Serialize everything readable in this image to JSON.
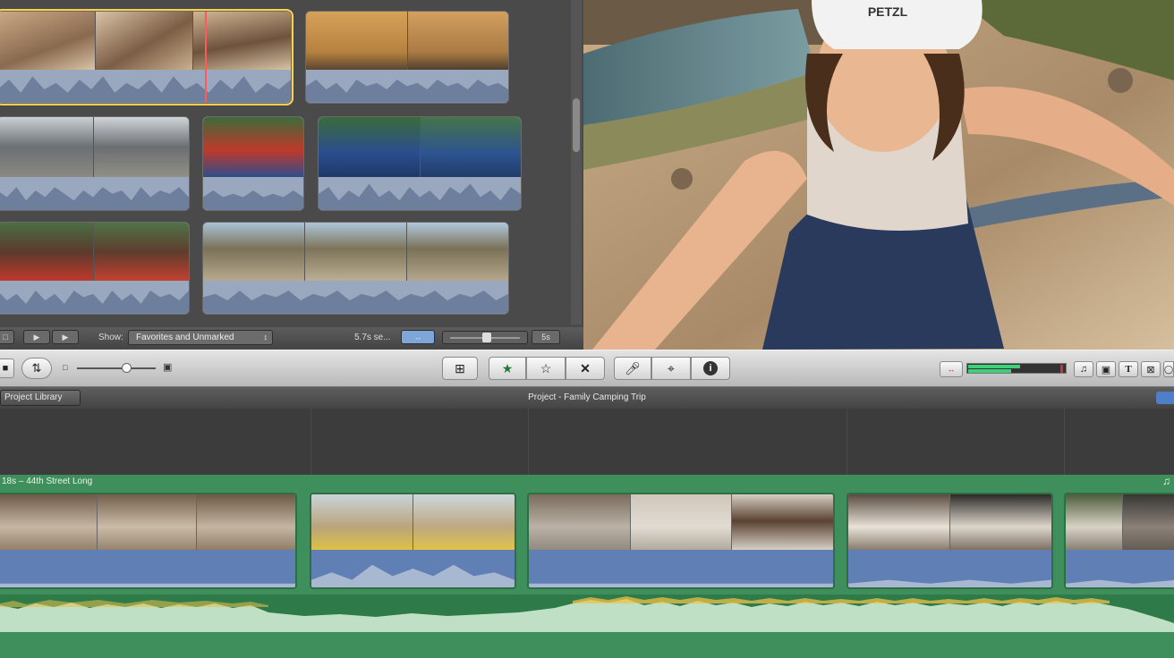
{
  "browser": {
    "show_label": "Show:",
    "show_filter": "Favorites and Unmarked",
    "clip_duration": "5.7s se...",
    "zoom_value": "5s"
  },
  "project": {
    "library_button": "Project Library",
    "title": "Project - Family Camping Trip"
  },
  "timeline": {
    "music_track_label": "18s – 44th Street Long"
  },
  "toolbar": {
    "buttons": [
      "add-to-project",
      "mark-favorite",
      "unmark",
      "reject",
      "voiceover",
      "crop",
      "inspector"
    ],
    "right_tools": [
      "music-icon",
      "camera-icon",
      "title-icon",
      "transition-icon"
    ]
  },
  "colors": {
    "music_track": "#3f8f5c",
    "audio_wave": "#5f7fb5",
    "playhead": "#ff5a5a",
    "favorite_star": "#1f7a35",
    "level_green": "#3ecf7a"
  }
}
